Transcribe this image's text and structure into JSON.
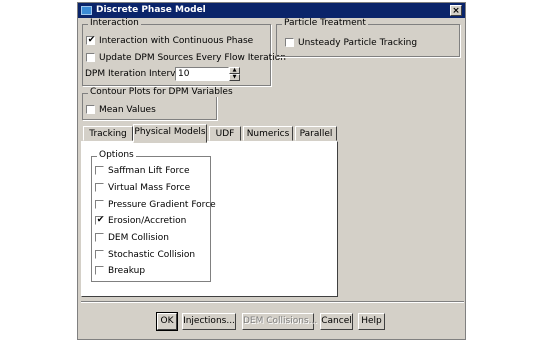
{
  "window": {
    "title": "Discrete Phase Model",
    "close": "×"
  },
  "interaction": {
    "label": "Interaction",
    "interaction_continuous": {
      "label": "Interaction with Continuous Phase",
      "checked": true
    },
    "update_dpm": {
      "label": "Update DPM Sources Every Flow Iteration",
      "checked": false
    },
    "dpm_interval_label": "DPM Iteration Interval",
    "dpm_interval_value": "10"
  },
  "particle_treatment": {
    "label": "Particle Treatment",
    "unsteady": {
      "label": "Unsteady Particle Tracking",
      "checked": false
    }
  },
  "contour_plots": {
    "label": "Contour Plots for DPM Variables",
    "mean_values": {
      "label": "Mean Values",
      "checked": false
    }
  },
  "tabs": [
    {
      "label": "Tracking",
      "active": false
    },
    {
      "label": "Physical Models",
      "active": true
    },
    {
      "label": "UDF",
      "active": false
    },
    {
      "label": "Numerics",
      "active": false
    },
    {
      "label": "Parallel",
      "active": false
    }
  ],
  "options": {
    "label": "Options",
    "items": [
      {
        "label": "Saffman Lift Force",
        "checked": false
      },
      {
        "label": "Virtual Mass Force",
        "checked": false
      },
      {
        "label": "Pressure Gradient Force",
        "checked": false
      },
      {
        "label": "Erosion/Accretion",
        "checked": true
      },
      {
        "label": "DEM Collision",
        "checked": false
      },
      {
        "label": "Stochastic Collision",
        "checked": false
      },
      {
        "label": "Breakup",
        "checked": false
      }
    ]
  },
  "buttons": {
    "ok": "OK",
    "injections": "Injections...",
    "dem_collisions": "DEM Collisions...",
    "cancel": "Cancel",
    "help": "Help"
  },
  "check_glyph": "✔"
}
